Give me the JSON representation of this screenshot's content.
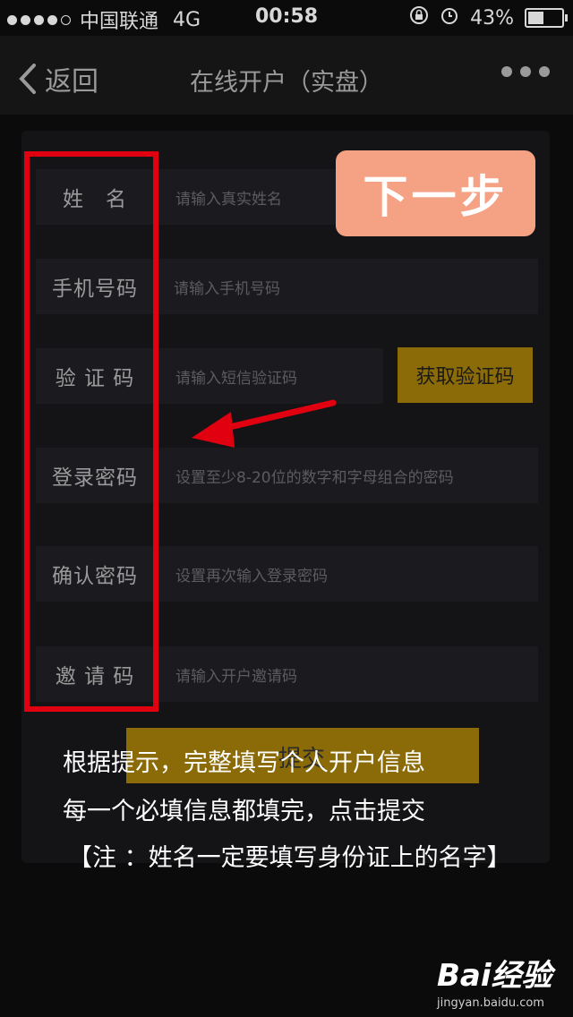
{
  "status_bar": {
    "carrier": "中国联通",
    "network": "4G",
    "time": "00:58",
    "battery": "43%",
    "battery_level": 0.43
  },
  "nav": {
    "back_label": "返回",
    "title": "在线开户（实盘）"
  },
  "form": {
    "fields": [
      {
        "label": "姓　名",
        "placeholder": "请输入真实姓名"
      },
      {
        "label": "手机号码",
        "placeholder": "请输入手机号码"
      },
      {
        "label": "验 证 码",
        "placeholder": "请输入短信验证码"
      },
      {
        "label": "登录密码",
        "placeholder": "设置至少8-20位的数字和字母组合的密码"
      },
      {
        "label": "确认密码",
        "placeholder": "设置再次输入登录密码"
      },
      {
        "label": "邀 请 码",
        "placeholder": "请输入开户邀请码"
      }
    ],
    "get_code_label": "获取验证码",
    "submit_label": "提交"
  },
  "overlay": {
    "next_step": "下一步",
    "instructions": [
      "根据提示，完整填写个人开户信息",
      "每一个必填信息都填完，点击提交",
      "【注 ：姓名一定要填写身份证上的名字】"
    ],
    "highlight_color": "#e00010",
    "next_color": "#f4a283"
  },
  "watermark": {
    "brand": "Bai经验",
    "url": "jingyan.baidu.com"
  }
}
